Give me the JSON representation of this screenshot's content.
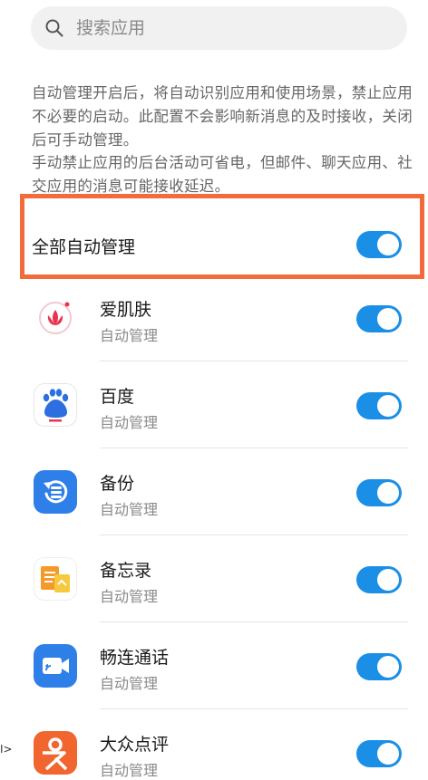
{
  "search": {
    "placeholder": "搜索应用"
  },
  "description": {
    "para1": "自动管理开启后，将自动识别应用和使用场景，禁止应用不必要的启动。此配置不会影响新消息的及时接收，关闭后可手动管理。",
    "para2": "手动禁止应用的后台活动可省电，但邮件、聊天应用、社交应用的消息可能接收延迟。"
  },
  "master": {
    "label": "全部自动管理",
    "enabled": true
  },
  "apps": [
    {
      "name": "爱肌肤",
      "status": "自动管理",
      "icon": "aijifu-lotus-icon",
      "enabled": true
    },
    {
      "name": "百度",
      "status": "自动管理",
      "icon": "baidu-paw-icon",
      "enabled": true
    },
    {
      "name": "备份",
      "status": "自动管理",
      "icon": "backup-icon",
      "enabled": true
    },
    {
      "name": "备忘录",
      "status": "自动管理",
      "icon": "notepad-icon",
      "enabled": true
    },
    {
      "name": "畅连通话",
      "status": "自动管理",
      "icon": "video-call-icon",
      "enabled": true
    },
    {
      "name": "大众点评",
      "status": "自动管理",
      "icon": "dianping-icon",
      "enabled": true
    }
  ],
  "colors": {
    "toggle_on": "#1b8fe6",
    "highlight_border": "#f26b3a",
    "dianping_orange": "#f0662e"
  },
  "edge_mark": "I>"
}
